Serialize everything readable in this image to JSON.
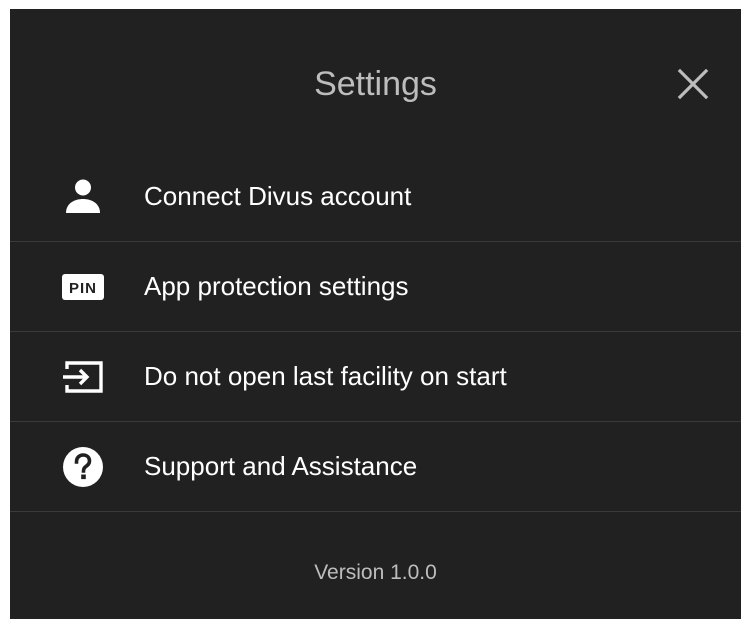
{
  "dialog": {
    "title": "Settings",
    "close_icon": "close-icon",
    "version": "Version 1.0.0"
  },
  "menu": {
    "items": [
      {
        "label": "Connect Divus account",
        "icon": "person-icon"
      },
      {
        "label": "App protection settings",
        "icon": "pin-icon",
        "icon_text": "PIN"
      },
      {
        "label": "Do not open last facility on start",
        "icon": "input-arrow-icon"
      },
      {
        "label": "Support and Assistance",
        "icon": "help-circle-icon"
      }
    ]
  },
  "colors": {
    "background": "#212121",
    "title": "#bdbdbd",
    "text": "#ffffff",
    "divider": "#3a3a3a"
  }
}
